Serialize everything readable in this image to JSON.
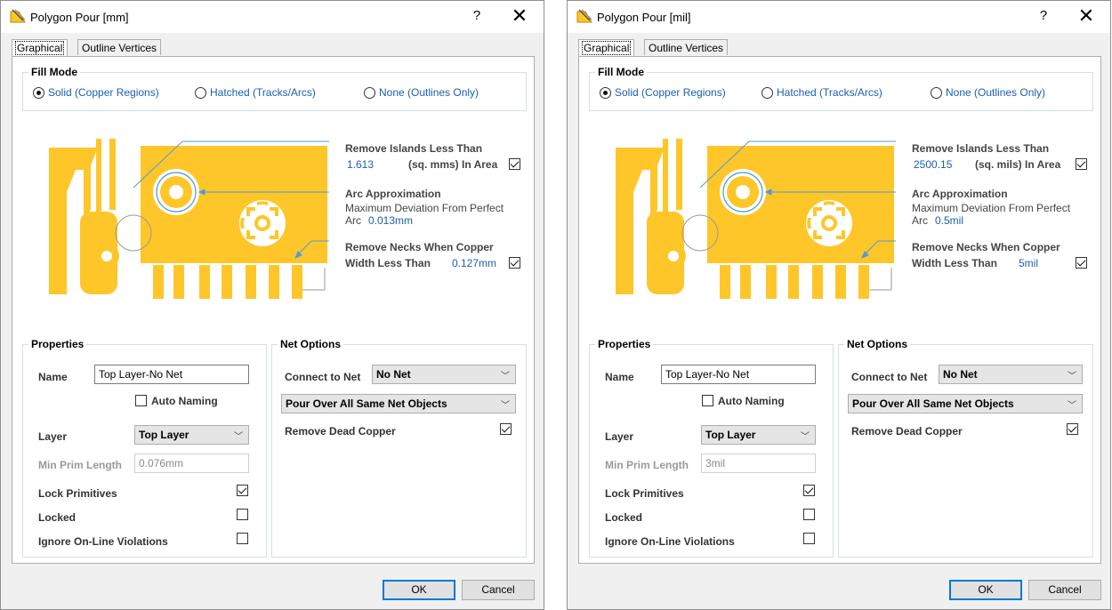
{
  "dialogs": [
    {
      "title": "Polygon Pour [mm]",
      "help": "?",
      "close": "✕",
      "tabs": [
        "Graphical",
        "Outline Vertices"
      ],
      "fill_mode": {
        "legend": "Fill Mode",
        "options": [
          "Solid (Copper Regions)",
          "Hatched (Tracks/Arcs)",
          "None (Outlines Only)"
        ],
        "selected": "Solid (Copper Regions)"
      },
      "remove_islands": {
        "title": "Remove Islands Less Than",
        "value": "1.613",
        "unit": "(sq. mms) In Area",
        "checked": true
      },
      "arc_approx": {
        "title": "Arc Approximation",
        "line1": "Maximum Deviation From Perfect",
        "prefix": "Arc",
        "value": "0.013mm"
      },
      "remove_necks": {
        "title": "Remove Necks When Copper",
        "line2": "Width Less Than",
        "value": "0.127mm",
        "checked": true
      },
      "properties": {
        "legend": "Properties",
        "name_label": "Name",
        "name_value": "Top Layer-No Net",
        "auto_naming": "Auto Naming",
        "auto_naming_checked": false,
        "layer_label": "Layer",
        "layer_value": "Top Layer",
        "min_prim_label": "Min Prim Length",
        "min_prim_value": "0.076mm",
        "lock_primitives": "Lock Primitives",
        "lock_primitives_checked": true,
        "locked": "Locked",
        "locked_checked": false,
        "ignore_online": "Ignore On-Line Violations",
        "ignore_online_checked": false
      },
      "net_options": {
        "legend": "Net Options",
        "connect_label": "Connect to Net",
        "connect_value": "No Net",
        "pour_over": "Pour Over All Same Net Objects",
        "remove_dead": "Remove Dead Copper",
        "remove_dead_checked": true
      },
      "ok": "OK",
      "cancel": "Cancel"
    },
    {
      "title": "Polygon Pour [mil]",
      "help": "?",
      "close": "✕",
      "tabs": [
        "Graphical",
        "Outline Vertices"
      ],
      "fill_mode": {
        "legend": "Fill Mode",
        "options": [
          "Solid (Copper Regions)",
          "Hatched (Tracks/Arcs)",
          "None (Outlines Only)"
        ],
        "selected": "Solid (Copper Regions)"
      },
      "remove_islands": {
        "title": "Remove Islands Less Than",
        "value": "2500.15",
        "unit": "(sq. mils)  In Area",
        "checked": true
      },
      "arc_approx": {
        "title": "Arc Approximation",
        "line1": "Maximum Deviation From Perfect",
        "prefix": "Arc",
        "value": "0.5mil"
      },
      "remove_necks": {
        "title": "Remove Necks When Copper",
        "line2": "Width Less Than",
        "value": "5mil",
        "checked": true
      },
      "properties": {
        "legend": "Properties",
        "name_label": "Name",
        "name_value": "Top Layer-No Net",
        "auto_naming": "Auto Naming",
        "auto_naming_checked": false,
        "layer_label": "Layer",
        "layer_value": "Top Layer",
        "min_prim_label": "Min Prim Length",
        "min_prim_value": "3mil",
        "lock_primitives": "Lock Primitives",
        "lock_primitives_checked": true,
        "locked": "Locked",
        "locked_checked": false,
        "ignore_online": "Ignore On-Line Violations",
        "ignore_online_checked": false
      },
      "net_options": {
        "legend": "Net Options",
        "connect_label": "Connect to Net",
        "connect_value": "No Net",
        "pour_over": "Pour Over All Same Net Objects",
        "remove_dead": "Remove Dead Copper",
        "remove_dead_checked": true
      },
      "ok": "OK",
      "cancel": "Cancel"
    }
  ],
  "colors": {
    "copper": "#ffc629",
    "accent_blue": "#1a5fb4",
    "arrow_blue": "#4a9fd8"
  }
}
